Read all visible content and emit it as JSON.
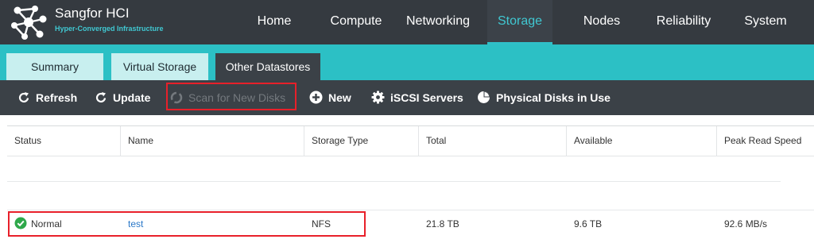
{
  "app": {
    "title": "Sangfor HCI",
    "subtitle": "Hyper-Converged Infrastructure"
  },
  "nav": {
    "items": [
      {
        "label": "Home"
      },
      {
        "label": "Compute"
      },
      {
        "label": "Networking"
      },
      {
        "label": "Storage"
      },
      {
        "label": "Nodes"
      },
      {
        "label": "Reliability"
      },
      {
        "label": "System"
      }
    ],
    "active": "Storage"
  },
  "tabs": {
    "items": [
      {
        "label": "Summary"
      },
      {
        "label": "Virtual Storage"
      },
      {
        "label": "Other Datastores"
      }
    ],
    "active": "Other Datastores"
  },
  "toolbar": {
    "refresh": {
      "label": "Refresh",
      "icon": "refresh-icon"
    },
    "update": {
      "label": "Update",
      "icon": "refresh-icon"
    },
    "scan": {
      "label": "Scan for New Disks",
      "icon": "spinner-icon",
      "disabled": true
    },
    "new": {
      "label": "New",
      "icon": "plus-circle-icon"
    },
    "iscsi": {
      "label": "iSCSI Servers",
      "icon": "gear-icon"
    },
    "physical": {
      "label": "Physical Disks in Use",
      "icon": "pie-chart-icon"
    }
  },
  "grid": {
    "columns": [
      "Status",
      "Name",
      "Storage Type",
      "Total",
      "Available",
      "Peak Read Speed"
    ],
    "rows": [
      {
        "status": "Normal",
        "name": "test",
        "storage_type": "NFS",
        "total": "21.8 TB",
        "available": "9.6 TB",
        "peak_read_speed": "92.6 MB/s"
      }
    ]
  },
  "colors": {
    "topbar": "#353a40",
    "accent": "#40c8d2",
    "tabstrip": "#2cc0c5",
    "highlight": "#e8202a",
    "status_ok": "#2ea84a",
    "link": "#2a78c8"
  }
}
